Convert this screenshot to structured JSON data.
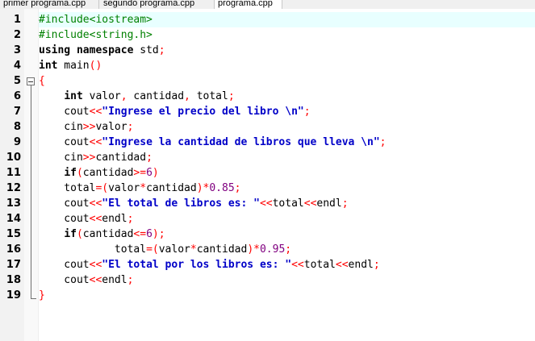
{
  "tabs": [
    {
      "label": "primer programa.cpp"
    },
    {
      "label": "segundo programa.cpp"
    },
    {
      "label": "programa.cpp",
      "active": true
    }
  ],
  "editor": {
    "current_line": 1,
    "lines": [
      {
        "n": "1",
        "tokens": [
          {
            "t": "#include<iostream>",
            "c": "pp"
          }
        ]
      },
      {
        "n": "2",
        "tokens": [
          {
            "t": "#include<string.h>",
            "c": "pp"
          }
        ]
      },
      {
        "n": "3",
        "tokens": [
          {
            "t": "using",
            "c": "kw"
          },
          {
            "t": " "
          },
          {
            "t": "namespace",
            "c": "kw"
          },
          {
            "t": " std"
          },
          {
            "t": ";",
            "c": "op"
          }
        ]
      },
      {
        "n": "4",
        "tokens": [
          {
            "t": "int",
            "c": "kw"
          },
          {
            "t": " main"
          },
          {
            "t": "()",
            "c": "op"
          }
        ]
      },
      {
        "n": "5",
        "tokens": [
          {
            "t": "{",
            "c": "op"
          }
        ]
      },
      {
        "n": "6",
        "tokens": [
          {
            "t": "    "
          },
          {
            "t": "int",
            "c": "kw"
          },
          {
            "t": " valor"
          },
          {
            "t": ",",
            "c": "op"
          },
          {
            "t": " cantidad"
          },
          {
            "t": ",",
            "c": "op"
          },
          {
            "t": " total"
          },
          {
            "t": ";",
            "c": "op"
          }
        ]
      },
      {
        "n": "7",
        "tokens": [
          {
            "t": "    cout"
          },
          {
            "t": "<<",
            "c": "op"
          },
          {
            "t": "\"Ingrese el precio del libro \\n\"",
            "c": "str"
          },
          {
            "t": ";",
            "c": "op"
          }
        ]
      },
      {
        "n": "8",
        "tokens": [
          {
            "t": "    cin"
          },
          {
            "t": ">>",
            "c": "op"
          },
          {
            "t": "valor"
          },
          {
            "t": ";",
            "c": "op"
          }
        ]
      },
      {
        "n": "9",
        "tokens": [
          {
            "t": "    cout"
          },
          {
            "t": "<<",
            "c": "op"
          },
          {
            "t": "\"Ingrese la cantidad de libros que lleva \\n\"",
            "c": "str"
          },
          {
            "t": ";",
            "c": "op"
          }
        ]
      },
      {
        "n": "10",
        "tokens": [
          {
            "t": "    cin"
          },
          {
            "t": ">>",
            "c": "op"
          },
          {
            "t": "cantidad"
          },
          {
            "t": ";",
            "c": "op"
          }
        ]
      },
      {
        "n": "11",
        "tokens": [
          {
            "t": "    "
          },
          {
            "t": "if",
            "c": "kw"
          },
          {
            "t": "(",
            "c": "op"
          },
          {
            "t": "cantidad"
          },
          {
            "t": ">=",
            "c": "op"
          },
          {
            "t": "6",
            "c": "num"
          },
          {
            "t": ")",
            "c": "op"
          }
        ]
      },
      {
        "n": "12",
        "tokens": [
          {
            "t": "    total"
          },
          {
            "t": "=(",
            "c": "op"
          },
          {
            "t": "valor"
          },
          {
            "t": "*",
            "c": "op"
          },
          {
            "t": "cantidad"
          },
          {
            "t": ")*",
            "c": "op"
          },
          {
            "t": "0.85",
            "c": "num"
          },
          {
            "t": ";",
            "c": "op"
          }
        ]
      },
      {
        "n": "13",
        "tokens": [
          {
            "t": "    cout"
          },
          {
            "t": "<<",
            "c": "op"
          },
          {
            "t": "\"El total de libros es: \"",
            "c": "str"
          },
          {
            "t": "<<",
            "c": "op"
          },
          {
            "t": "total"
          },
          {
            "t": "<<",
            "c": "op"
          },
          {
            "t": "endl"
          },
          {
            "t": ";",
            "c": "op"
          }
        ]
      },
      {
        "n": "14",
        "tokens": [
          {
            "t": "    cout"
          },
          {
            "t": "<<",
            "c": "op"
          },
          {
            "t": "endl"
          },
          {
            "t": ";",
            "c": "op"
          }
        ]
      },
      {
        "n": "15",
        "tokens": [
          {
            "t": "    "
          },
          {
            "t": "if",
            "c": "kw"
          },
          {
            "t": "(",
            "c": "op"
          },
          {
            "t": "cantidad"
          },
          {
            "t": "<=",
            "c": "op"
          },
          {
            "t": "6",
            "c": "num"
          },
          {
            "t": ");",
            "c": "op"
          }
        ]
      },
      {
        "n": "16",
        "tokens": [
          {
            "t": "            total"
          },
          {
            "t": "=(",
            "c": "op"
          },
          {
            "t": "valor"
          },
          {
            "t": "*",
            "c": "op"
          },
          {
            "t": "cantidad"
          },
          {
            "t": ")*",
            "c": "op"
          },
          {
            "t": "0.95",
            "c": "num"
          },
          {
            "t": ";",
            "c": "op"
          }
        ]
      },
      {
        "n": "17",
        "tokens": [
          {
            "t": "    cout"
          },
          {
            "t": "<<",
            "c": "op"
          },
          {
            "t": "\"El total por los libros es: \"",
            "c": "str"
          },
          {
            "t": "<<",
            "c": "op"
          },
          {
            "t": "total"
          },
          {
            "t": "<<",
            "c": "op"
          },
          {
            "t": "endl"
          },
          {
            "t": ";",
            "c": "op"
          }
        ]
      },
      {
        "n": "18",
        "tokens": [
          {
            "t": "    cout"
          },
          {
            "t": "<<",
            "c": "op"
          },
          {
            "t": "endl"
          },
          {
            "t": ";",
            "c": "op"
          }
        ]
      },
      {
        "n": "19",
        "tokens": [
          {
            "t": "}",
            "c": "op"
          }
        ]
      }
    ]
  },
  "colors": {
    "current_line_bg": "#e8ffff",
    "preprocessor": "#008000",
    "string": "#0000c8",
    "number": "#800080",
    "operator": "#ff0000"
  }
}
